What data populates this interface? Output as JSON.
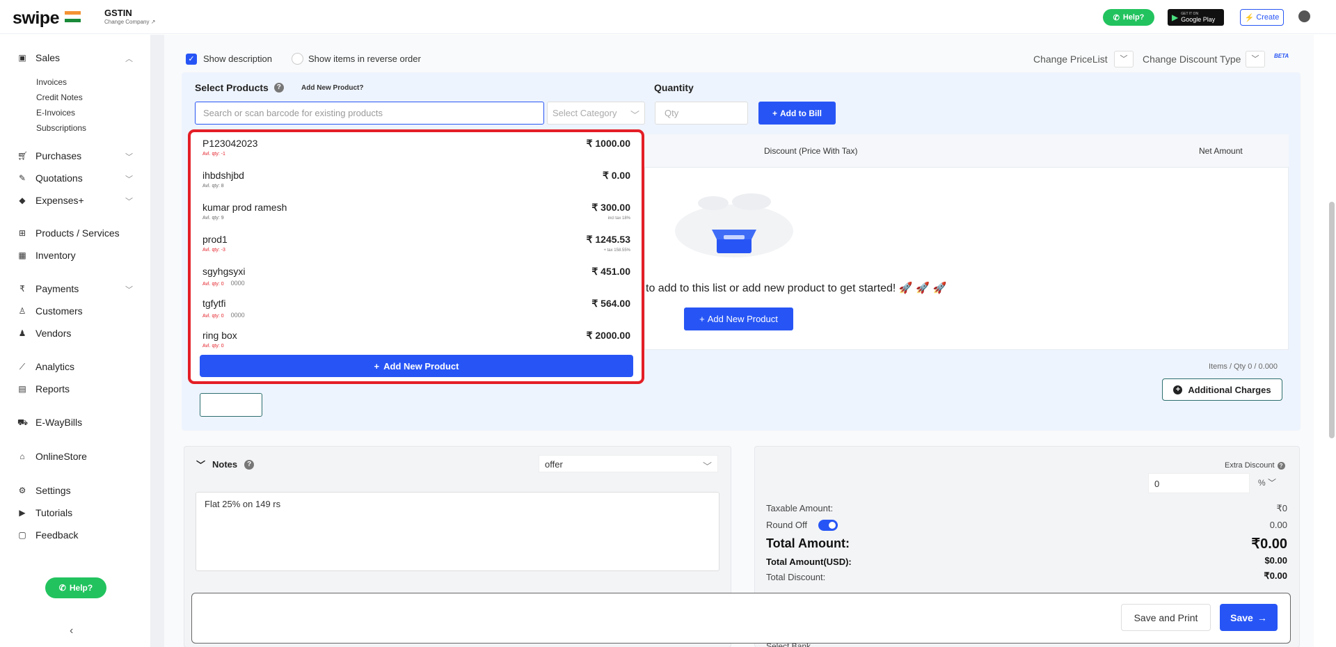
{
  "header": {
    "logo_text": "swipe",
    "gstin_label": "GSTIN",
    "change_company": "Change Company",
    "help_label": "Help?",
    "gplay_top": "GET IT ON",
    "gplay_bottom": "Google Play",
    "create_label": "Create"
  },
  "sidebar": {
    "sales": "Sales",
    "sales_sub": [
      "Invoices",
      "Credit Notes",
      "E-Invoices",
      "Subscriptions"
    ],
    "purchases": "Purchases",
    "quotations": "Quotations",
    "expenses": "Expenses+",
    "products": "Products / Services",
    "inventory": "Inventory",
    "payments": "Payments",
    "customers": "Customers",
    "vendors": "Vendors",
    "analytics": "Analytics",
    "reports": "Reports",
    "ewaybills": "E-WayBills",
    "onlinestore": "OnlineStore",
    "settings": "Settings",
    "tutorials": "Tutorials",
    "feedback": "Feedback",
    "help": "Help?"
  },
  "options": {
    "show_description": "Show description",
    "reverse_order": "Show items in reverse order",
    "change_pricelist": "Change PriceList",
    "change_discount_type": "Change Discount Type",
    "beta": "BETA"
  },
  "products_section": {
    "title": "Select Products",
    "add_new_link": "Add New Product?",
    "quantity_label": "Quantity",
    "search_placeholder": "Search or scan barcode for existing products",
    "category_placeholder": "Select Category",
    "qty_placeholder": "Qty",
    "add_to_bill": "Add to Bill"
  },
  "table": {
    "col_discount": "Discount (Price With Tax)",
    "col_net": "Net Amount",
    "empty_message": "to add to this list or add new product to get started! 🚀 🚀 🚀",
    "add_new_button": "Add New Product",
    "items_qty": "Items / Qty 0 / 0.000",
    "additional_charges": "Additional Charges"
  },
  "dropdown": {
    "items": [
      {
        "name": "P123042023",
        "qty": "Avl. qty: -1",
        "neg": true,
        "code": "",
        "price": "₹ 1000.00",
        "tax": ""
      },
      {
        "name": "ihbdshjbd",
        "qty": "Avl. qty: 8",
        "neg": false,
        "code": "",
        "price": "₹ 0.00",
        "tax": ""
      },
      {
        "name": "kumar prod ramesh",
        "qty": "Avl. qty: 9",
        "neg": false,
        "code": "",
        "price": "₹ 300.00",
        "tax": "incl tax 18%"
      },
      {
        "name": "prod1",
        "qty": "Avl. qty: -3",
        "neg": true,
        "code": "",
        "price": "₹ 1245.53",
        "tax": "+ tax 158.55%"
      },
      {
        "name": "sgyhgsyxi",
        "qty": "Avl. qty: 0",
        "neg": true,
        "code": "0000",
        "price": "₹ 451.00",
        "tax": ""
      },
      {
        "name": "tgfytfi",
        "qty": "Avl. qty: 0",
        "neg": true,
        "code": "0000",
        "price": "₹ 564.00",
        "tax": ""
      },
      {
        "name": "ring box",
        "qty": "Avl. qty: 0",
        "neg": true,
        "code": "",
        "price": "₹ 2000.00",
        "tax": ""
      }
    ],
    "add_new_button": "Add New Product"
  },
  "notes": {
    "title": "Notes",
    "selected": "offer",
    "text": "Flat 25% on 149 rs"
  },
  "totals": {
    "extra_discount_label": "Extra Discount",
    "extra_discount_value": "0",
    "discount_unit": "%",
    "taxable_label": "Taxable Amount:",
    "taxable_value": "₹0",
    "round_off_label": "Round Off",
    "round_off_value": "0.00",
    "total_label": "Total Amount:",
    "total_value": "₹0.00",
    "total_usd_label": "Total Amount(USD):",
    "total_usd_value": "$0.00",
    "total_discount_label": "Total Discount:",
    "total_discount_value": "₹0.00",
    "select_bank": "Select Bank"
  },
  "footer": {
    "save_print": "Save and Print",
    "save": "Save"
  },
  "colors": {
    "accent": "#2755f5",
    "highlight": "#e41e26",
    "whatsapp": "#22c35e"
  }
}
